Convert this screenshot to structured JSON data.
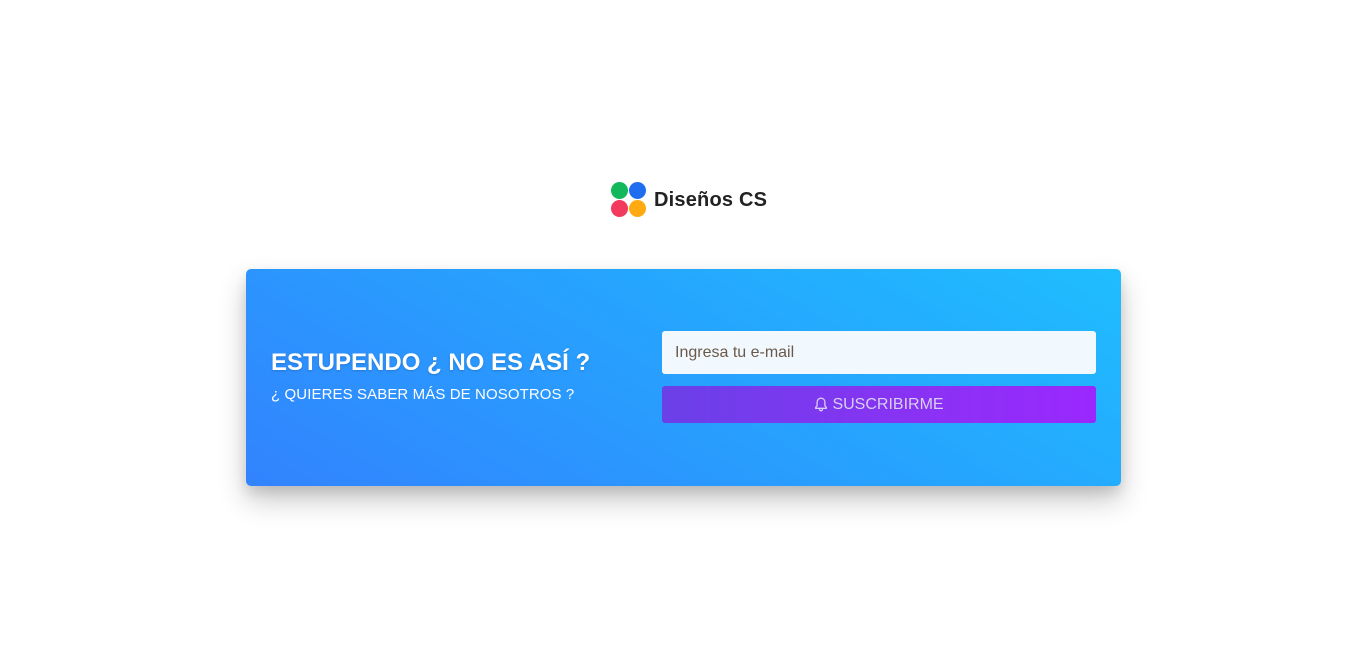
{
  "brand": {
    "name": "Diseños CS",
    "logo_colors": [
      "#12b85a",
      "#1f6ef0",
      "#f2395e",
      "#ffaa10"
    ]
  },
  "promo": {
    "headline": "ESTUPENDO ¿ NO ES ASÍ ?",
    "subline": "¿ QUIERES SABER MÁS DE NOSOTROS ?"
  },
  "subscribe": {
    "email_value": "",
    "email_placeholder": "Ingresa tu e-mail",
    "button_icon": "bell-icon",
    "button_label": "SUSCRIBIRME"
  },
  "colors": {
    "card_gradient_start": "#3283fe",
    "card_gradient_end": "#1fbdfe",
    "button_gradient_start": "#6a40e8",
    "button_gradient_end": "#9a28fe"
  }
}
